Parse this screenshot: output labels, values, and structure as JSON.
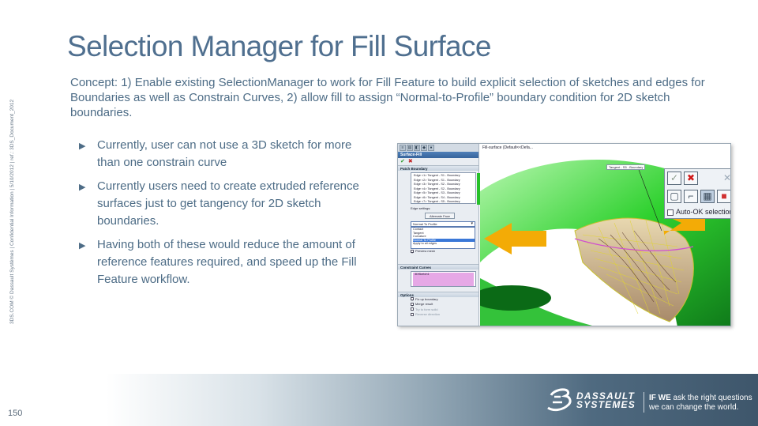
{
  "slide": {
    "title": "Selection Manager for Fill Surface",
    "concept": "Concept: 1) Enable existing SelectionManager to work for Fill Feature to build explicit selection of sketches and edges for Boundaries as well as Constrain Curves, 2) allow fill to assign “Normal-to-Profile” boundary condition for 2D sketch boundaries.",
    "bullets": [
      "Currently, user can not use a 3D sketch for more than one constrain curve",
      "Currently users need to create extruded reference surfaces just to get tangency for 2D sketch boundaries.",
      "Having both of these would reduce the amount of reference features required, and speed up the Fill Feature workflow."
    ],
    "side_note": "3DS.COM © Dassault Systèmes | Confidential Information | 5/10/2012 | ref.: 3DS_Document_2012",
    "page_number": "150"
  },
  "footer": {
    "brand_line1": "DASSAULT",
    "brand_line2": "SYSTEMES",
    "tagline_bold": "IF WE",
    "tagline_rest": " ask the right questions",
    "tagline_line2": "we can change the world.",
    "colors": {
      "band_dark": "#3e566b",
      "band_mid": "#8ea3b2"
    }
  },
  "property_manager": {
    "title": "Surface-Fill",
    "patch_boundary_header": "Patch Boundary",
    "boundaries": [
      "Edge <1> Tangent - S1 - Boundary",
      "Edge <2> Tangent - S1 - Boundary",
      "Edge <3> Tangent - S2 - Boundary",
      "Edge <4> Tangent - S2 - Boundary",
      "Edge <5> Tangent - S3 - Boundary",
      "Edge <6> Tangent - S4 - Boundary",
      "Edge <7> Tangent - S5 - Boundary"
    ],
    "edge_settings_label": "Edge settings:",
    "alternate_face_button": "Alternate Face",
    "condition_selected": "Normal To Profile",
    "condition_options": [
      "Contact",
      "Tangent",
      "Curvature",
      "Normal To Profile"
    ],
    "apply_all_label": "Apply to all edges",
    "preview_mesh_label": "Preview mesh",
    "constraint_header": "Constraint Curves",
    "constraint_item": "3DSketch1",
    "options_header": "Options",
    "options": [
      {
        "label": "Fix up boundary",
        "checked": true,
        "enabled": true
      },
      {
        "label": "Merge result",
        "checked": true,
        "enabled": true
      },
      {
        "label": "Try to form solid",
        "checked": false,
        "enabled": false
      },
      {
        "label": "Reverse direction",
        "checked": false,
        "enabled": false
      }
    ]
  },
  "viewport": {
    "header": "Fill-surface (Default<<Defa...",
    "tag_label": "Tangent - S5 - Boundary",
    "auto_ok_label": "Auto-OK selections",
    "arrow_color": "#f3ab06",
    "surface_color": "#2fd12f"
  }
}
